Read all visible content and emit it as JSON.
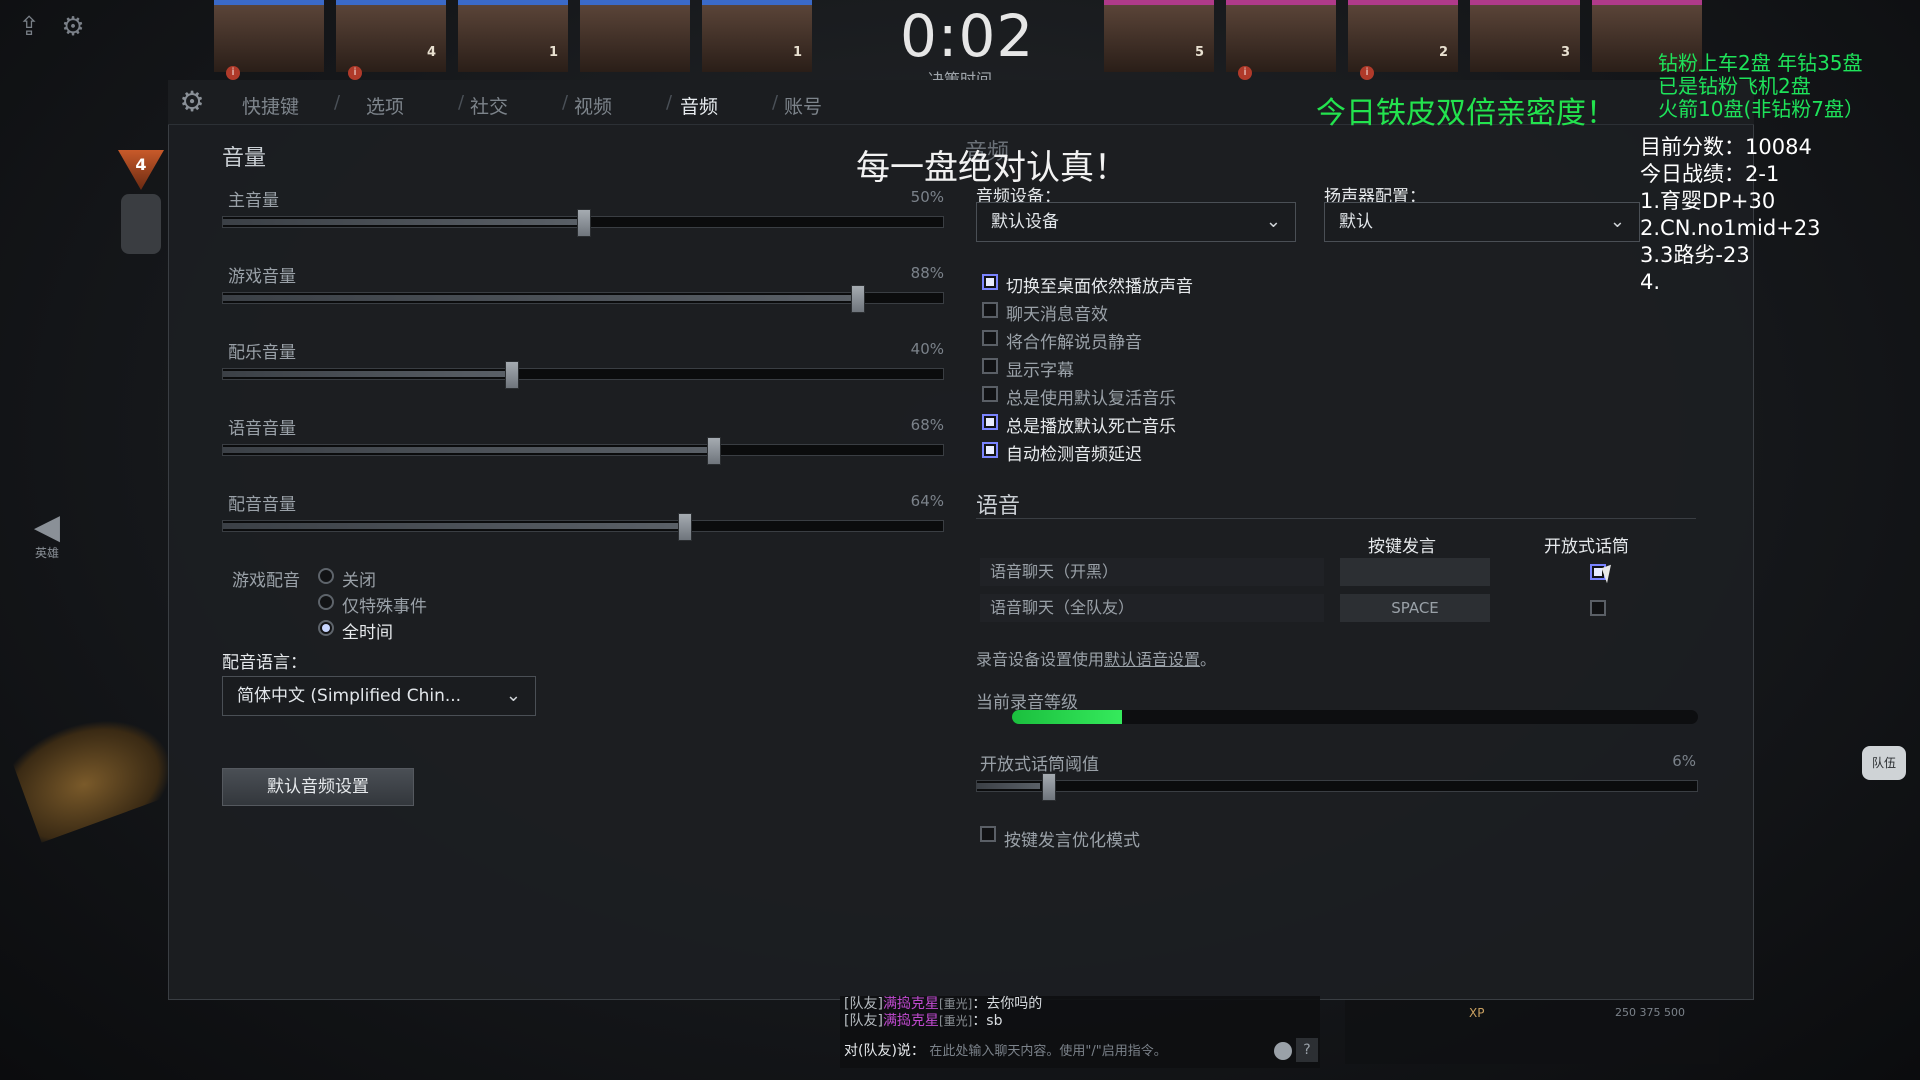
{
  "top": {
    "timer": "0:02",
    "timer_sub": "决策时间",
    "heroes_left": [
      {
        "num": "",
        "warn": true
      },
      {
        "num": "4",
        "warn": true
      },
      {
        "num": "1",
        "warn": false
      },
      {
        "num": "",
        "warn": false
      },
      {
        "num": "1",
        "warn": false
      }
    ],
    "heroes_right": [
      {
        "num": "5",
        "warn": false
      },
      {
        "num": "",
        "warn": true
      },
      {
        "num": "2",
        "warn": true
      },
      {
        "num": "3",
        "warn": false
      },
      {
        "num": "",
        "warn": false
      }
    ]
  },
  "tabs": [
    "快捷键",
    "选项",
    "社交",
    "视频",
    "音频",
    "账号"
  ],
  "active_tab": "音频",
  "promo": "今日铁皮双倍亲密度！",
  "overlay_title": "每一盘绝对认真！",
  "overlay_behind_title": "音频",
  "volume": {
    "title": "音量",
    "sliders": [
      {
        "label": "主音量",
        "pct": "50%",
        "value": 0.5
      },
      {
        "label": "游戏音量",
        "pct": "88%",
        "value": 0.88
      },
      {
        "label": "配乐音量",
        "pct": "40%",
        "value": 0.4
      },
      {
        "label": "语音音量",
        "pct": "68%",
        "value": 0.68
      },
      {
        "label": "配音音量",
        "pct": "64%",
        "value": 0.64
      }
    ],
    "announcer_label": "游戏配音",
    "announcer_options": [
      "关闭",
      "仅特殊事件",
      "全时间"
    ],
    "announcer_selected": 2,
    "language_label": "配音语言：",
    "language_value": "简体中文 (Simplified Chin...",
    "default_button": "默认音频设置"
  },
  "devices": {
    "audio_device_label": "音频设备：",
    "audio_device_value": "默认设备",
    "speaker_label": "扬声器配置：",
    "speaker_value": "默认"
  },
  "checkboxes": [
    {
      "label": "切换至桌面依然播放声音",
      "checked": true
    },
    {
      "label": "聊天消息音效",
      "checked": false
    },
    {
      "label": "将合作解说员静音",
      "checked": false
    },
    {
      "label": "显示字幕",
      "checked": false
    },
    {
      "label": "总是使用默认复活音乐",
      "checked": false
    },
    {
      "label": "总是播放默认死亡音乐",
      "checked": true
    },
    {
      "label": "自动检测音频延迟",
      "checked": true
    }
  ],
  "voice": {
    "title": "语音",
    "col_ptt": "按键发言",
    "col_open": "开放式话筒",
    "rows": [
      {
        "label": "语音聊天（开黑）",
        "key": "",
        "open": true
      },
      {
        "label": "语音聊天（全队友）",
        "key": "SPACE",
        "open": false
      }
    ],
    "record_note_prefix": "录音设备设置使用",
    "record_note_link": "默认语音设置",
    "record_note_suffix": "。",
    "level_label": "当前录音等级",
    "level_value": 0.16,
    "threshold_label": "开放式话筒阈值",
    "threshold_pct": "6%",
    "threshold_value": 0.06,
    "ptt_opt_label": "按键发言优化模式",
    "ptt_opt_checked": false
  },
  "left_nav": {
    "label": "英雄"
  },
  "stream_overlay": {
    "green_lines": [
      "钻粉上车2盘 年钻35盘",
      "已是钻粉飞机2盘",
      "火箭10盘(非钻粉7盘）"
    ],
    "white_lines": [
      "目前分数：10084",
      "今日战绩：2-1",
      "1.育婴DP+30",
      "2.CN.no1mid+23",
      "3.3路劣-23",
      "4."
    ]
  },
  "chat": {
    "lines": [
      {
        "prefix": "[队友]",
        "name": "满捣克星",
        "tag": "[重光]",
        "text": "：去你吗的"
      },
      {
        "prefix": "[队友]",
        "name": "满捣克星",
        "tag": "[重光]",
        "text": "：sb"
      }
    ],
    "input_prefix": "对(队友)说：",
    "input_placeholder": "在此处输入聊天内容。使用\"/\"启用指令。"
  },
  "bottom_right": {
    "xp": "XP",
    "ticks": "250  375  500"
  },
  "side_badge": "队伍",
  "level_badge": "4"
}
